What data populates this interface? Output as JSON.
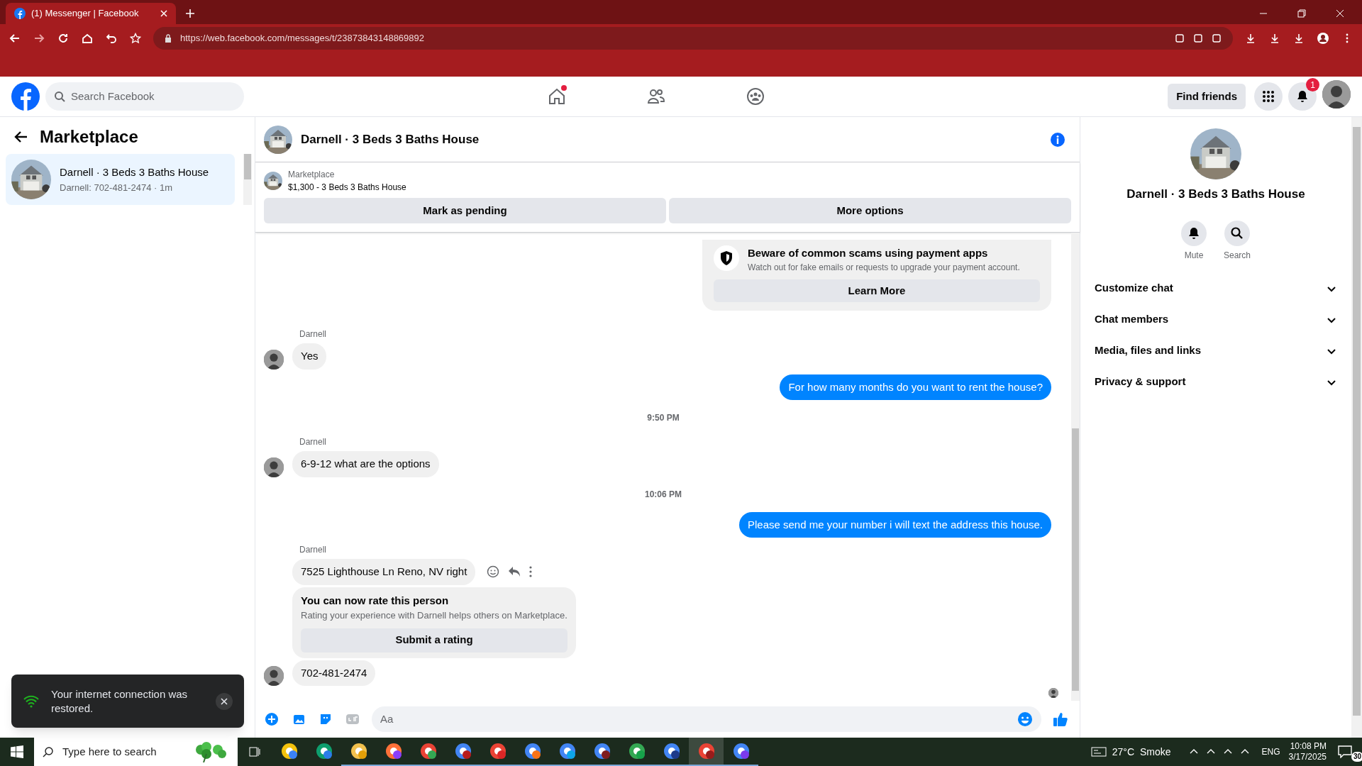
{
  "browser": {
    "tab_title": "(1) Messenger | Facebook",
    "url": "https://web.facebook.com/messages/t/23873843148869892"
  },
  "header": {
    "search_placeholder": "Search Facebook",
    "nav": [
      {
        "kind": "home",
        "selected": false,
        "dot": true
      },
      {
        "kind": "friends",
        "selected": false,
        "dot": false
      },
      {
        "kind": "groups",
        "selected": false,
        "dot": false
      }
    ],
    "find_friends": "Find friends",
    "notification_count": "1"
  },
  "sidebar": {
    "title": "Marketplace",
    "chats": [
      {
        "title": "Darnell · 3 Beds 3 Baths House",
        "preview": "Darnell: 702-481-2474 · 1m",
        "selected": true
      }
    ]
  },
  "chat": {
    "title": "Darnell · 3 Beds 3 Baths House",
    "listing": {
      "source": "Marketplace",
      "summary": "$1,300 - 3 Beds 3 Baths House"
    },
    "actions": [
      "Mark as pending",
      "More options"
    ],
    "messages": [
      {
        "kind": "notice",
        "title": "Beware of common scams using payment apps",
        "body": "Watch out for fake emails or requests to upgrade your payment account.",
        "button": "Learn More"
      },
      {
        "kind": "incoming",
        "sender": "Darnell",
        "text": "Yes",
        "avatar": true,
        "actions": false
      },
      {
        "kind": "outgoing",
        "text": "For how many months do you want to rent the house?"
      },
      {
        "kind": "timestamp",
        "text": "9:50 PM"
      },
      {
        "kind": "incoming",
        "sender": "Darnell",
        "text": "6-9-12 what are the options",
        "avatar": true,
        "actions": false
      },
      {
        "kind": "timestamp",
        "text": "10:06 PM"
      },
      {
        "kind": "outgoing",
        "text": "Please send me your number i will text the address this house."
      },
      {
        "kind": "incoming",
        "sender": "Darnell",
        "text": "7525 Lighthouse Ln Reno, NV right",
        "avatar": false,
        "actions": true
      },
      {
        "kind": "rating",
        "title": "You can now rate this person",
        "body": "Rating your experience with Darnell helps others on Marketplace.",
        "button": "Submit a rating"
      },
      {
        "kind": "incoming",
        "text": "702-481-2474",
        "avatar": true,
        "actions": false
      }
    ],
    "composer_placeholder": "Aa"
  },
  "details": {
    "title": "Darnell · 3 Beds 3 Baths House",
    "buttons": [
      {
        "kind": "mute",
        "label": "Mute"
      },
      {
        "kind": "search",
        "label": "Search"
      }
    ],
    "sections": [
      {
        "label": "Customize chat",
        "expanded": false
      },
      {
        "label": "Chat members",
        "expanded": false
      },
      {
        "label": "Media, files and links",
        "expanded": false
      },
      {
        "label": "Privacy & support",
        "expanded": false
      }
    ]
  },
  "toast": {
    "text": "Your internet connection was restored."
  },
  "taskbar": {
    "search_placeholder": "Type here to search",
    "weather_temp": "27°C",
    "weather_text": "Smoke",
    "language": "ENG",
    "time": "10:08 PM",
    "date": "3/17/2025",
    "notification_count": "30"
  }
}
